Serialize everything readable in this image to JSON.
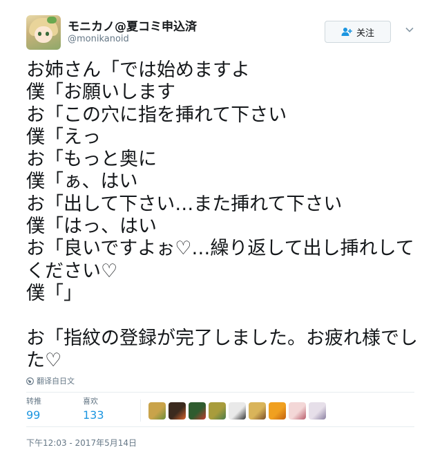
{
  "user": {
    "display_name": "モニカノ@夏コミ申込済",
    "screen_name": "@monikanoid"
  },
  "follow_button": {
    "label": "关注",
    "icon": "add-user-icon"
  },
  "menu_icon": "chevron-down-icon",
  "tweet": {
    "text": "お姉さん「では始めますよ\n僕「お願いします\nお「この穴に指を挿れて下さい\n僕「えっ\nお「もっと奥に\n僕「ぁ、はい\nお「出して下さい…また挿れて下さい\n僕「はっ、はい\nお「良いですよぉ♡…繰り返して出し挿れしてください♡\n僕「」\n\nお「指紋の登録が完了しました。お疲れ様でした♡"
  },
  "translate": {
    "label": "翻译自日文",
    "icon": "globe-icon"
  },
  "stats": {
    "retweets": {
      "label": "转推",
      "value": "99"
    },
    "likes": {
      "label": "喜欢",
      "value": "133"
    }
  },
  "likers": [
    {
      "avatar_color": "#c9a34a",
      "accent": "#6b8e3a"
    },
    {
      "avatar_color": "#3b2a1e",
      "accent": "#d9642a"
    },
    {
      "avatar_color": "#2f5c2f",
      "accent": "#c23b2e"
    },
    {
      "avatar_color": "#a89c3c",
      "accent": "#4a7b4a"
    },
    {
      "avatar_color": "#e9e9e9",
      "accent": "#333333"
    },
    {
      "avatar_color": "#d9b45a",
      "accent": "#7a4e2a"
    },
    {
      "avatar_color": "#f0a020",
      "accent": "#c26010"
    },
    {
      "avatar_color": "#f3d7d7",
      "accent": "#b85c6b"
    },
    {
      "avatar_color": "#e6dfe9",
      "accent": "#8a7fa0"
    }
  ],
  "timestamp": "下午12:03 - 2017年5月14日",
  "colors": {
    "text": "#14171a",
    "muted": "#657786",
    "link_blue": "#1b95e0",
    "divider": "#e6ecf0"
  }
}
